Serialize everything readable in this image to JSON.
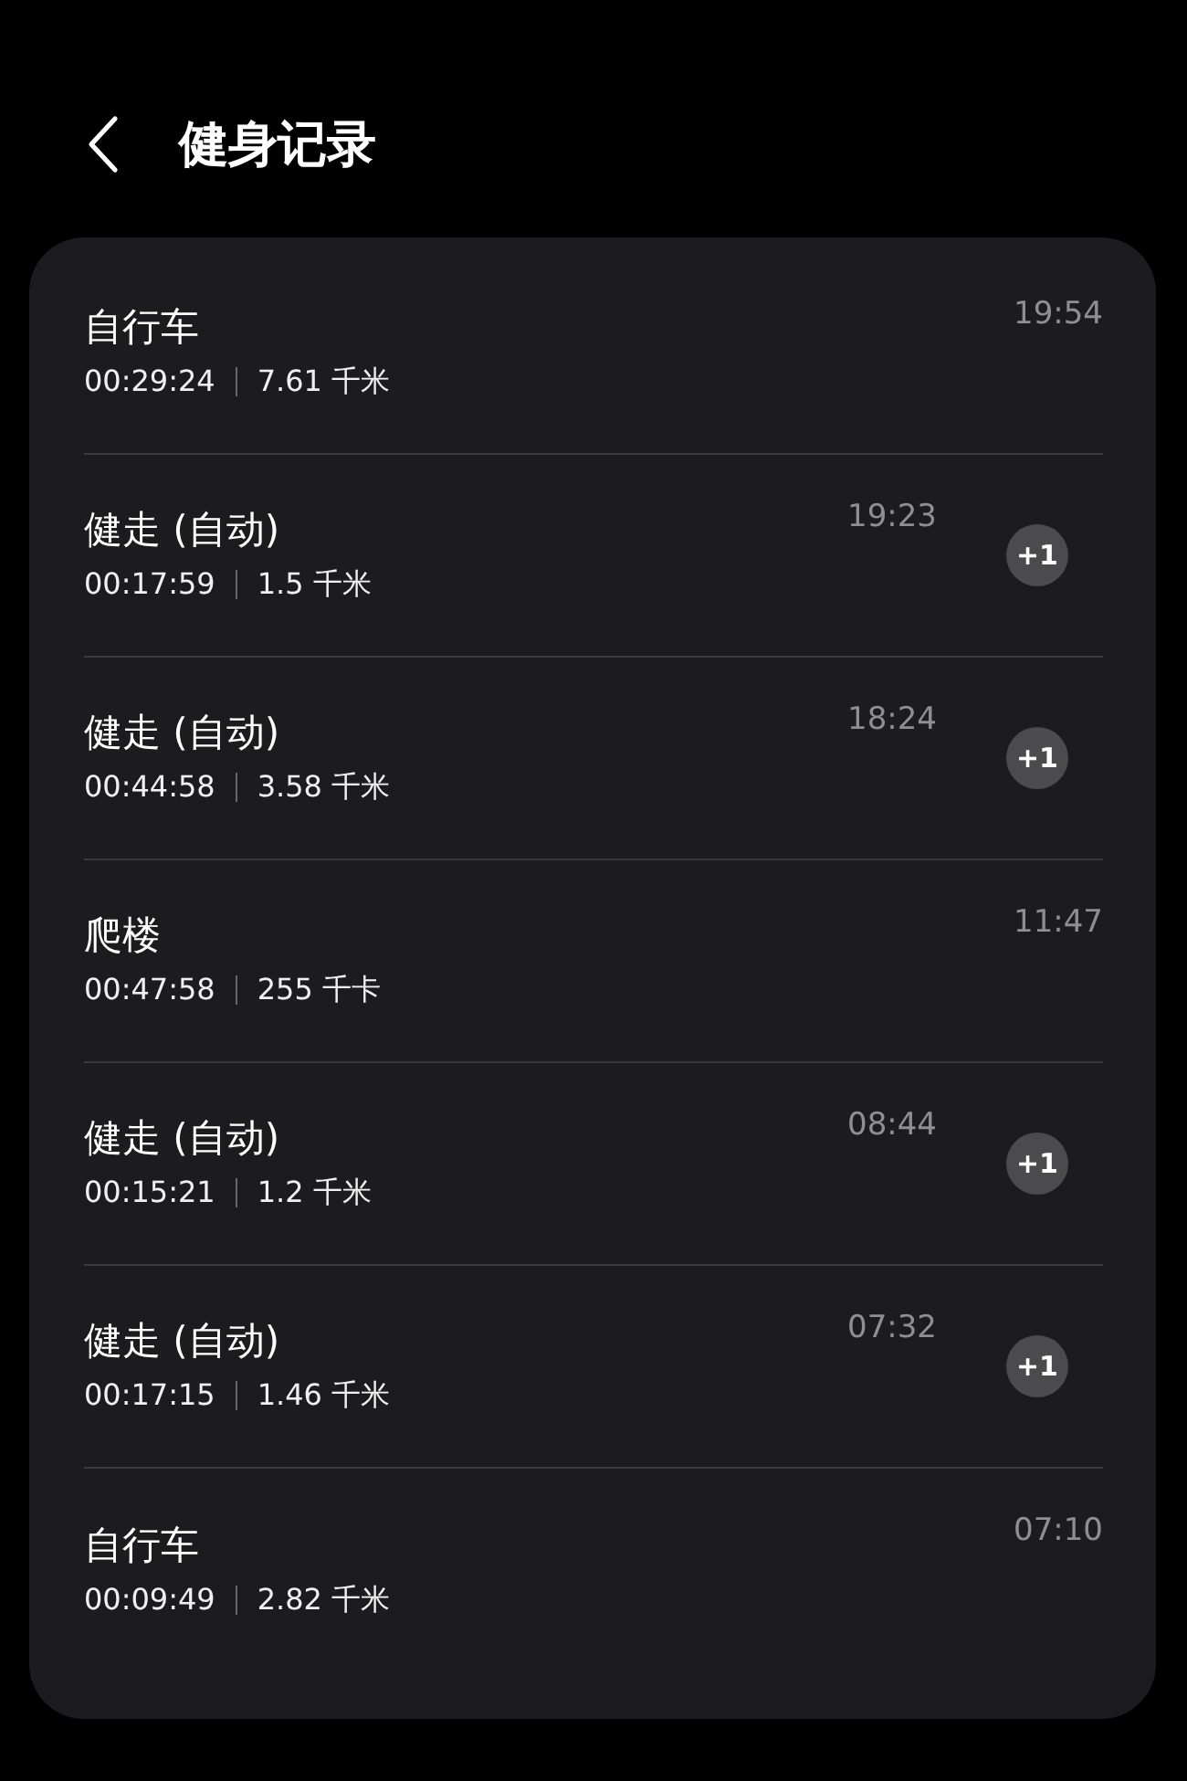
{
  "header": {
    "title": "健身记录"
  },
  "records": [
    {
      "title": "自行车",
      "duration": "00:29:24",
      "amount": "7.61 千米",
      "time": "19:54"
    },
    {
      "title": "健走 (自动)",
      "duration": "00:17:59",
      "amount": "1.5 千米",
      "time": "19:23",
      "badge": "+1"
    },
    {
      "title": "健走 (自动)",
      "duration": "00:44:58",
      "amount": "3.58 千米",
      "time": "18:24",
      "badge": "+1"
    },
    {
      "title": "爬楼",
      "duration": "00:47:58",
      "amount": "255 千卡",
      "time": "11:47"
    },
    {
      "title": "健走 (自动)",
      "duration": "00:15:21",
      "amount": "1.2 千米",
      "time": "08:44",
      "badge": "+1"
    },
    {
      "title": "健走 (自动)",
      "duration": "00:17:15",
      "amount": "1.46 千米",
      "time": "07:32",
      "badge": "+1"
    },
    {
      "title": "自行车",
      "duration": "00:09:49",
      "amount": "2.82 千米",
      "time": "07:10"
    }
  ]
}
